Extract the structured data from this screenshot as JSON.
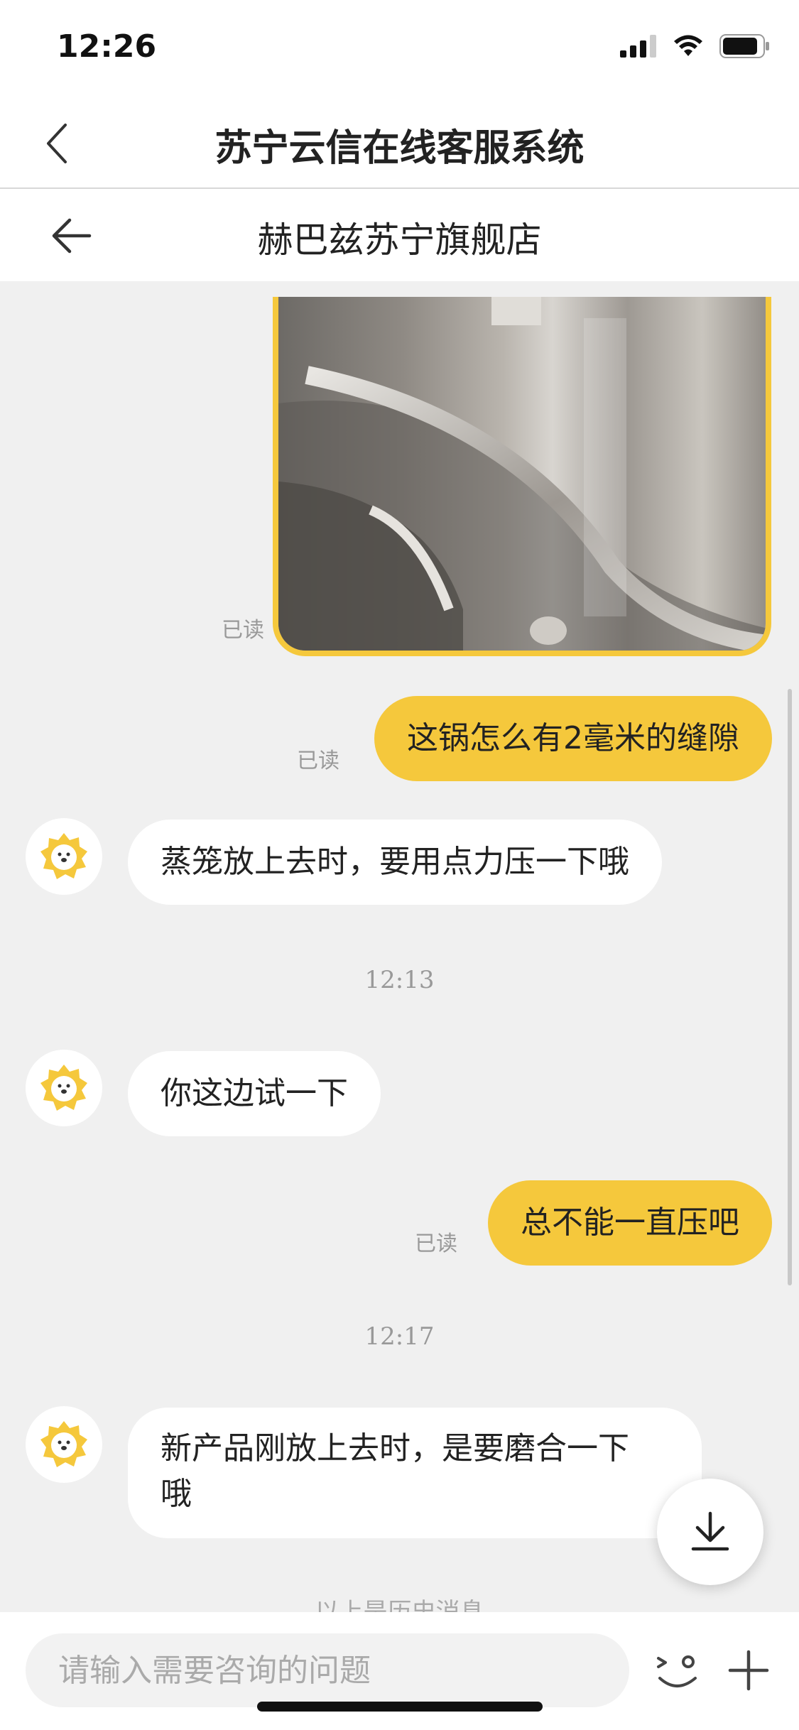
{
  "status_bar": {
    "time": "12:26"
  },
  "nav": {
    "title": "苏宁云信在线客服系统"
  },
  "store": {
    "name": "赫巴兹苏宁旗舰店"
  },
  "messages": {
    "m1_read": "已读",
    "m2": {
      "text": "这锅怎么有2毫米的缝隙",
      "read": "已读"
    },
    "m3": {
      "text": "蒸笼放上去时，要用点力压一下哦"
    },
    "t1": "12:13",
    "m4": {
      "text": "你这边试一下"
    },
    "m5": {
      "text": "总不能一直压吧",
      "read": "已读"
    },
    "t2": "12:17",
    "m6": {
      "line1": "新产品刚放上去时，是要磨合一下",
      "line2": "哦"
    },
    "history_note": "以上是历史消息"
  },
  "input": {
    "placeholder": "请输入需要咨询的问题"
  },
  "colors": {
    "accent": "#f5c83c",
    "chat_bg": "#f0f0f0"
  },
  "icons": [
    "back-chevron-icon",
    "back-arrow-icon",
    "signal-icon",
    "wifi-icon",
    "battery-icon",
    "lion-avatar-icon",
    "download-icon",
    "emoji-icon",
    "plus-icon"
  ]
}
